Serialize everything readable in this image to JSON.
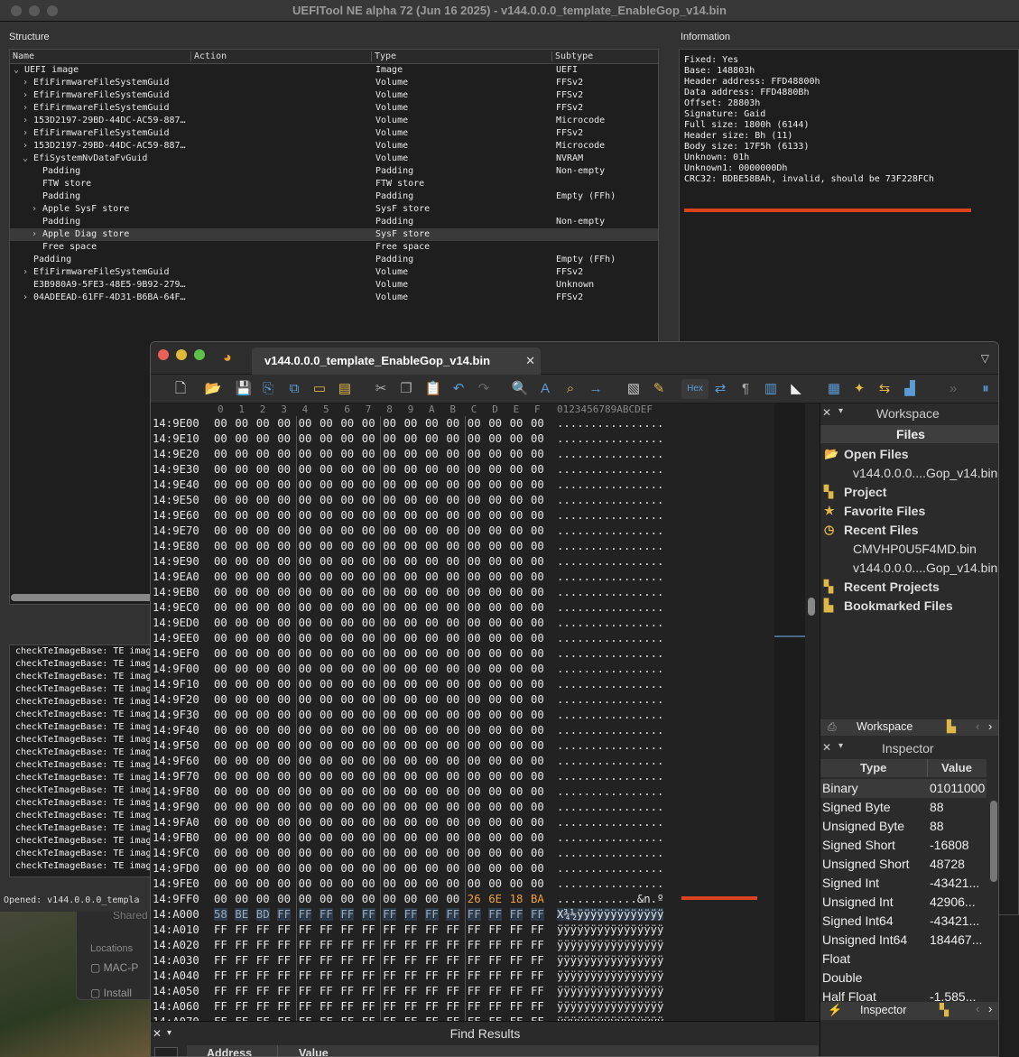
{
  "app": {
    "title": "UEFITool NE alpha 72 (Jun 16 2025) - v144.0.0.0_template_EnableGop_v14.bin"
  },
  "structure": {
    "label": "Structure",
    "columns": [
      "Name",
      "Action",
      "Type",
      "Subtype"
    ],
    "rows": [
      {
        "name": "UEFI image",
        "action": "",
        "type": "Image",
        "subtype": "UEFI",
        "level": 0,
        "chevron": "v"
      },
      {
        "name": "EfiFirmwareFileSystemGuid",
        "action": "",
        "type": "Volume",
        "subtype": "FFSv2",
        "level": 1,
        "chevron": ">"
      },
      {
        "name": "EfiFirmwareFileSystemGuid",
        "action": "",
        "type": "Volume",
        "subtype": "FFSv2",
        "level": 1,
        "chevron": ">"
      },
      {
        "name": "EfiFirmwareFileSystemGuid",
        "action": "",
        "type": "Volume",
        "subtype": "FFSv2",
        "level": 1,
        "chevron": ">"
      },
      {
        "name": "153D2197-29BD-44DC-AC59-887…",
        "action": "",
        "type": "Volume",
        "subtype": "Microcode",
        "level": 1,
        "chevron": ">"
      },
      {
        "name": "EfiFirmwareFileSystemGuid",
        "action": "",
        "type": "Volume",
        "subtype": "FFSv2",
        "level": 1,
        "chevron": ">"
      },
      {
        "name": "153D2197-29BD-44DC-AC59-887…",
        "action": "",
        "type": "Volume",
        "subtype": "Microcode",
        "level": 1,
        "chevron": ">"
      },
      {
        "name": "EfiSystemNvDataFvGuid",
        "action": "",
        "type": "Volume",
        "subtype": "NVRAM",
        "level": 1,
        "chevron": "v"
      },
      {
        "name": "Padding",
        "action": "",
        "type": "Padding",
        "subtype": "Non-empty",
        "level": 2,
        "chevron": ""
      },
      {
        "name": "FTW store",
        "action": "",
        "type": "FTW store",
        "subtype": "",
        "level": 2,
        "chevron": ""
      },
      {
        "name": "Padding",
        "action": "",
        "type": "Padding",
        "subtype": "Empty (FFh)",
        "level": 2,
        "chevron": ""
      },
      {
        "name": "Apple SysF store",
        "action": "",
        "type": "SysF store",
        "subtype": "",
        "level": 2,
        "chevron": ">"
      },
      {
        "name": "Padding",
        "action": "",
        "type": "Padding",
        "subtype": "Non-empty",
        "level": 2,
        "chevron": ""
      },
      {
        "name": "Apple Diag store",
        "action": "",
        "type": "SysF store",
        "subtype": "",
        "level": 2,
        "chevron": ">",
        "selected": true
      },
      {
        "name": "Free space",
        "action": "",
        "type": "Free space",
        "subtype": "",
        "level": 2,
        "chevron": ""
      },
      {
        "name": "Padding",
        "action": "",
        "type": "Padding",
        "subtype": "Empty (FFh)",
        "level": 1,
        "chevron": ""
      },
      {
        "name": "EfiFirmwareFileSystemGuid",
        "action": "",
        "type": "Volume",
        "subtype": "FFSv2",
        "level": 1,
        "chevron": ">"
      },
      {
        "name": "E3B980A9-5FE3-48E5-9B92-279…",
        "action": "",
        "type": "Volume",
        "subtype": "Unknown",
        "level": 1,
        "chevron": ""
      },
      {
        "name": "04ADEEAD-61FF-4D31-B6BA-64F…",
        "action": "",
        "type": "Volume",
        "subtype": "FFSv2",
        "level": 1,
        "chevron": ">"
      }
    ]
  },
  "information": {
    "label": "Information",
    "lines": [
      "Fixed: Yes",
      "Base: 148803h",
      "Header address: FFD48800h",
      "Data address: FFD4880Bh",
      "Offset: 28803h",
      "Signature: Gaid",
      "Full size: 1800h (6144)",
      "Header size: Bh (11)",
      "Body size: 17F5h (6133)",
      "Unknown: 01h",
      "Unknown1: 0000000Dh",
      "CRC32: BDBE58BAh, invalid, should be 73F228FCh"
    ]
  },
  "log": {
    "lines": [
      "checkTeImageBase: TE imag",
      "checkTeImageBase: TE imag",
      "checkTeImageBase: TE imag",
      "checkTeImageBase: TE imag",
      "checkTeImageBase: TE imag",
      "checkTeImageBase: TE imag",
      "checkTeImageBase: TE imag",
      "checkTeImageBase: TE imag",
      "checkTeImageBase: TE imag",
      "checkTeImageBase: TE imag",
      "checkTeImageBase: TE imag",
      "checkTeImageBase: TE imag",
      "checkTeImageBase: TE imag",
      "checkTeImageBase: TE imag",
      "checkTeImageBase: TE imag",
      "checkTeImageBase: TE imag",
      "checkTeImageBase: TE imag",
      "checkTeImageBase: TE imag"
    ]
  },
  "status": {
    "text": "Opened: v144.0.0.0_templa"
  },
  "finder": {
    "shared": "Shared",
    "locations": "Locations",
    "mac": "MAC-P",
    "install": "Install"
  },
  "hex_editor": {
    "tab_label": "v144.0.0.0_template_EnableGop_v14.bin",
    "hex_button": "Hex",
    "column_header": [
      "0",
      "1",
      "2",
      "3",
      "4",
      "5",
      "6",
      "7",
      "8",
      "9",
      "A",
      "B",
      "C",
      "D",
      "E",
      "F"
    ],
    "ascii_header": "0123456789ABCDEF",
    "rows": [
      {
        "addr": "14:9E00",
        "bytes": "00 00 00 00 00 00 00 00 00 00 00 00 00 00 00 00",
        "ascii": "................"
      },
      {
        "addr": "14:9E10",
        "bytes": "00 00 00 00 00 00 00 00 00 00 00 00 00 00 00 00",
        "ascii": "................"
      },
      {
        "addr": "14:9E20",
        "bytes": "00 00 00 00 00 00 00 00 00 00 00 00 00 00 00 00",
        "ascii": "................"
      },
      {
        "addr": "14:9E30",
        "bytes": "00 00 00 00 00 00 00 00 00 00 00 00 00 00 00 00",
        "ascii": "................"
      },
      {
        "addr": "14:9E40",
        "bytes": "00 00 00 00 00 00 00 00 00 00 00 00 00 00 00 00",
        "ascii": "................"
      },
      {
        "addr": "14:9E50",
        "bytes": "00 00 00 00 00 00 00 00 00 00 00 00 00 00 00 00",
        "ascii": "................"
      },
      {
        "addr": "14:9E60",
        "bytes": "00 00 00 00 00 00 00 00 00 00 00 00 00 00 00 00",
        "ascii": "................"
      },
      {
        "addr": "14:9E70",
        "bytes": "00 00 00 00 00 00 00 00 00 00 00 00 00 00 00 00",
        "ascii": "................"
      },
      {
        "addr": "14:9E80",
        "bytes": "00 00 00 00 00 00 00 00 00 00 00 00 00 00 00 00",
        "ascii": "................"
      },
      {
        "addr": "14:9E90",
        "bytes": "00 00 00 00 00 00 00 00 00 00 00 00 00 00 00 00",
        "ascii": "................"
      },
      {
        "addr": "14:9EA0",
        "bytes": "00 00 00 00 00 00 00 00 00 00 00 00 00 00 00 00",
        "ascii": "................"
      },
      {
        "addr": "14:9EB0",
        "bytes": "00 00 00 00 00 00 00 00 00 00 00 00 00 00 00 00",
        "ascii": "................"
      },
      {
        "addr": "14:9EC0",
        "bytes": "00 00 00 00 00 00 00 00 00 00 00 00 00 00 00 00",
        "ascii": "................"
      },
      {
        "addr": "14:9ED0",
        "bytes": "00 00 00 00 00 00 00 00 00 00 00 00 00 00 00 00",
        "ascii": "................"
      },
      {
        "addr": "14:9EE0",
        "bytes": "00 00 00 00 00 00 00 00 00 00 00 00 00 00 00 00",
        "ascii": "................"
      },
      {
        "addr": "14:9EF0",
        "bytes": "00 00 00 00 00 00 00 00 00 00 00 00 00 00 00 00",
        "ascii": "................"
      },
      {
        "addr": "14:9F00",
        "bytes": "00 00 00 00 00 00 00 00 00 00 00 00 00 00 00 00",
        "ascii": "................"
      },
      {
        "addr": "14:9F10",
        "bytes": "00 00 00 00 00 00 00 00 00 00 00 00 00 00 00 00",
        "ascii": "................"
      },
      {
        "addr": "14:9F20",
        "bytes": "00 00 00 00 00 00 00 00 00 00 00 00 00 00 00 00",
        "ascii": "................"
      },
      {
        "addr": "14:9F30",
        "bytes": "00 00 00 00 00 00 00 00 00 00 00 00 00 00 00 00",
        "ascii": "................"
      },
      {
        "addr": "14:9F40",
        "bytes": "00 00 00 00 00 00 00 00 00 00 00 00 00 00 00 00",
        "ascii": "................"
      },
      {
        "addr": "14:9F50",
        "bytes": "00 00 00 00 00 00 00 00 00 00 00 00 00 00 00 00",
        "ascii": "................"
      },
      {
        "addr": "14:9F60",
        "bytes": "00 00 00 00 00 00 00 00 00 00 00 00 00 00 00 00",
        "ascii": "................"
      },
      {
        "addr": "14:9F70",
        "bytes": "00 00 00 00 00 00 00 00 00 00 00 00 00 00 00 00",
        "ascii": "................"
      },
      {
        "addr": "14:9F80",
        "bytes": "00 00 00 00 00 00 00 00 00 00 00 00 00 00 00 00",
        "ascii": "................"
      },
      {
        "addr": "14:9F90",
        "bytes": "00 00 00 00 00 00 00 00 00 00 00 00 00 00 00 00",
        "ascii": "................"
      },
      {
        "addr": "14:9FA0",
        "bytes": "00 00 00 00 00 00 00 00 00 00 00 00 00 00 00 00",
        "ascii": "................"
      },
      {
        "addr": "14:9FB0",
        "bytes": "00 00 00 00 00 00 00 00 00 00 00 00 00 00 00 00",
        "ascii": "................"
      },
      {
        "addr": "14:9FC0",
        "bytes": "00 00 00 00 00 00 00 00 00 00 00 00 00 00 00 00",
        "ascii": "................"
      },
      {
        "addr": "14:9FD0",
        "bytes": "00 00 00 00 00 00 00 00 00 00 00 00 00 00 00 00",
        "ascii": "................"
      },
      {
        "addr": "14:9FE0",
        "bytes": "00 00 00 00 00 00 00 00 00 00 00 00 00 00 00 00",
        "ascii": "................"
      },
      {
        "addr": "14:9FF0",
        "bytes": "00 00 00 00 00 00 00 00 00 00 00 00 26 6E 18 BA",
        "ascii": "............&n.º"
      },
      {
        "addr": "14:A000",
        "bytes": "58 BE BD FF FF FF FF FF FF FF FF FF FF FF FF FF",
        "ascii": "X¾½ÿÿÿÿÿÿÿÿÿÿÿÿÿ"
      },
      {
        "addr": "14:A010",
        "bytes": "FF FF FF FF FF FF FF FF FF FF FF FF FF FF FF FF",
        "ascii": "ÿÿÿÿÿÿÿÿÿÿÿÿÿÿÿÿ"
      },
      {
        "addr": "14:A020",
        "bytes": "FF FF FF FF FF FF FF FF FF FF FF FF FF FF FF FF",
        "ascii": "ÿÿÿÿÿÿÿÿÿÿÿÿÿÿÿÿ"
      },
      {
        "addr": "14:A030",
        "bytes": "FF FF FF FF FF FF FF FF FF FF FF FF FF FF FF FF",
        "ascii": "ÿÿÿÿÿÿÿÿÿÿÿÿÿÿÿÿ"
      },
      {
        "addr": "14:A040",
        "bytes": "FF FF FF FF FF FF FF FF FF FF FF FF FF FF FF FF",
        "ascii": "ÿÿÿÿÿÿÿÿÿÿÿÿÿÿÿÿ"
      },
      {
        "addr": "14:A050",
        "bytes": "FF FF FF FF FF FF FF FF FF FF FF FF FF FF FF FF",
        "ascii": "ÿÿÿÿÿÿÿÿÿÿÿÿÿÿÿÿ"
      },
      {
        "addr": "14:A060",
        "bytes": "FF FF FF FF FF FF FF FF FF FF FF FF FF FF FF FF",
        "ascii": "ÿÿÿÿÿÿÿÿÿÿÿÿÿÿÿÿ"
      },
      {
        "addr": "14:A070",
        "bytes": "FF FF FF FF FF FF FF FF FF FF FF FF FF FF FF FF",
        "ascii": "ÿÿÿÿÿÿÿÿÿÿÿÿÿÿÿÿ"
      }
    ],
    "highlight_color": "#f0a040",
    "accent_color": "#d9441e"
  },
  "workspace": {
    "title": "Workspace",
    "files_header": "Files",
    "items": [
      {
        "label": "Open Files",
        "bold": true,
        "icon": "folder-icon"
      },
      {
        "label": "v144.0.0.0....Gop_v14.bin",
        "bold": false,
        "icon": ""
      },
      {
        "label": "Project",
        "bold": true,
        "icon": "project-icon"
      },
      {
        "label": "Favorite Files",
        "bold": true,
        "icon": "favorite-icon"
      },
      {
        "label": "Recent Files",
        "bold": true,
        "icon": "recent-icon"
      },
      {
        "label": "CMVHP0U5F4MD.bin",
        "bold": false,
        "icon": ""
      },
      {
        "label": "v144.0.0.0....Gop_v14.bin",
        "bold": false,
        "icon": ""
      },
      {
        "label": "Recent Projects",
        "bold": true,
        "icon": "recent-projects-icon"
      },
      {
        "label": "Bookmarked Files",
        "bold": true,
        "icon": "bookmark-icon"
      }
    ],
    "tab_label": "Workspace"
  },
  "inspector": {
    "title": "Inspector",
    "col_type": "Type",
    "col_value": "Value",
    "rows": [
      {
        "type": "Binary",
        "value": "01011000"
      },
      {
        "type": "Signed Byte",
        "value": "88"
      },
      {
        "type": "Unsigned Byte",
        "value": "88"
      },
      {
        "type": "Signed Short",
        "value": "-16808"
      },
      {
        "type": "Unsigned Short",
        "value": "48728"
      },
      {
        "type": "Signed Int",
        "value": "-43421..."
      },
      {
        "type": "Unsigned Int",
        "value": "42906..."
      },
      {
        "type": "Signed Int64",
        "value": "-43421..."
      },
      {
        "type": "Unsigned Int64",
        "value": "184467..."
      },
      {
        "type": "Float",
        "value": ""
      },
      {
        "type": "Double",
        "value": ""
      },
      {
        "type": "Half Float",
        "value": "-1.585..."
      }
    ],
    "tab_label": "Inspector"
  },
  "find": {
    "title": "Find Results",
    "col_address": "Address",
    "col_value": "Value"
  }
}
